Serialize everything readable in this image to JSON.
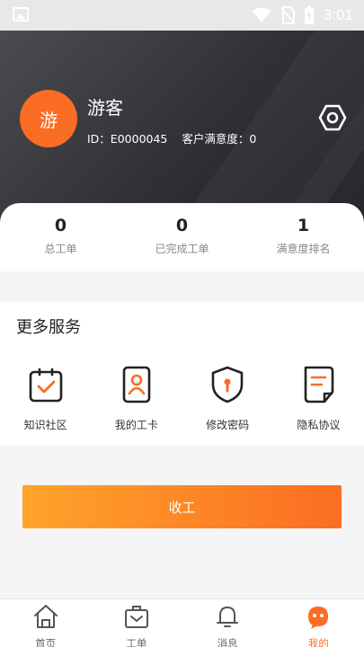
{
  "status_bar": {
    "time": "3:01"
  },
  "profile": {
    "avatar_text": "游",
    "name": "游客",
    "id_text": "ID：E0000045",
    "satisfaction_text": "客户满意度：0"
  },
  "stats": [
    {
      "value": "0",
      "label": "总工单"
    },
    {
      "value": "0",
      "label": "已完成工单"
    },
    {
      "value": "1",
      "label": "满意度排名"
    }
  ],
  "services": {
    "title": "更多服务",
    "items": [
      {
        "label": "知识社区",
        "icon": "clipboard-check-icon"
      },
      {
        "label": "我的工卡",
        "icon": "badge-person-icon"
      },
      {
        "label": "修改密码",
        "icon": "shield-keyhole-icon"
      },
      {
        "label": "隐私协议",
        "icon": "document-icon"
      }
    ]
  },
  "main_button": {
    "label": "收工"
  },
  "colors": {
    "accent": "#fb6d22",
    "accent_light": "#ffa42b",
    "header_dark": "#2e3034"
  },
  "tabbar": {
    "items": [
      {
        "label": "首页",
        "icon": "home-icon"
      },
      {
        "label": "工单",
        "icon": "briefcase-icon"
      },
      {
        "label": "消息",
        "icon": "bell-icon"
      },
      {
        "label": "我的",
        "icon": "profile-face-icon"
      }
    ],
    "active_index": 3
  }
}
